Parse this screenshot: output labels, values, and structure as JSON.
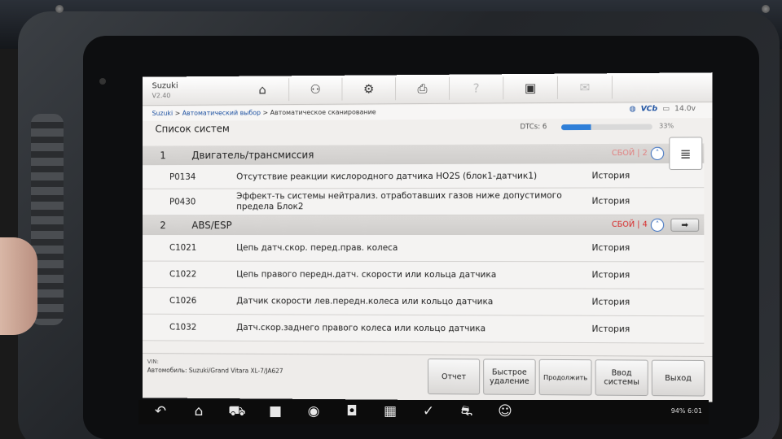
{
  "header": {
    "brand": "Suzuki",
    "version": "V2.40",
    "toolbar": [
      {
        "icon": "home-icon",
        "glyph": "⌂"
      },
      {
        "icon": "car-vehicle-icon",
        "glyph": "⚇"
      },
      {
        "icon": "gear-icon",
        "glyph": "⚙"
      },
      {
        "icon": "print-icon",
        "glyph": "⎙"
      },
      {
        "icon": "help-icon",
        "glyph": "?"
      },
      {
        "icon": "save-icon",
        "glyph": "▣"
      },
      {
        "icon": "message-icon",
        "glyph": "✉"
      }
    ]
  },
  "breadcrumb": {
    "part1": "Suzuki",
    "sep1": " > ",
    "part2": "Автоматический выбор",
    "sep2": " > ",
    "part3": "Автоматическое сканирование"
  },
  "status": {
    "vcb": "VCb",
    "battery": "14.0v"
  },
  "list": {
    "title": "Список систем",
    "dtcs_label": "DTCs: 6",
    "progress_label": "33%",
    "progress": 0.33
  },
  "systems": [
    {
      "num": "1",
      "name": "Двигатель/трансмиссия",
      "fault": "СБОЙ | 2",
      "dtcs": [
        {
          "code": "P0134",
          "desc": "Отсутствие реакции кислородного датчика HO2S (блок1-датчик1)",
          "status": "История"
        },
        {
          "code": "P0430",
          "desc": "Эффект-ть системы нейтрализ. отработавших газов ниже допустимого предела Блок2",
          "status": "История"
        }
      ]
    },
    {
      "num": "2",
      "name": "ABS/ESP",
      "fault": "СБОЙ | 4",
      "dtcs": [
        {
          "code": "C1021",
          "desc": "Цепь датч.скор. перед.прав. колеса",
          "status": "История"
        },
        {
          "code": "C1022",
          "desc": "Цепь правого передн.датч. скорости или кольца датчика",
          "status": "История"
        },
        {
          "code": "C1026",
          "desc": "Датчик скорости лев.передн.колеса или кольцо датчика",
          "status": "История"
        },
        {
          "code": "C1032",
          "desc": "Датч.скор.заднего правого колеса или кольцо датчика",
          "status": "История"
        }
      ]
    }
  ],
  "footer": {
    "vin_label": "VIN:",
    "vehicle_label": "Автомобиль: Suzuki/Grand Vitara XL-7/JA627",
    "buttons": [
      "Отчет",
      "Быстрое удаление",
      "Продолжить",
      "Ввод системы",
      "Выход"
    ]
  },
  "navbar": {
    "battery": "94%",
    "time": "6:01"
  }
}
